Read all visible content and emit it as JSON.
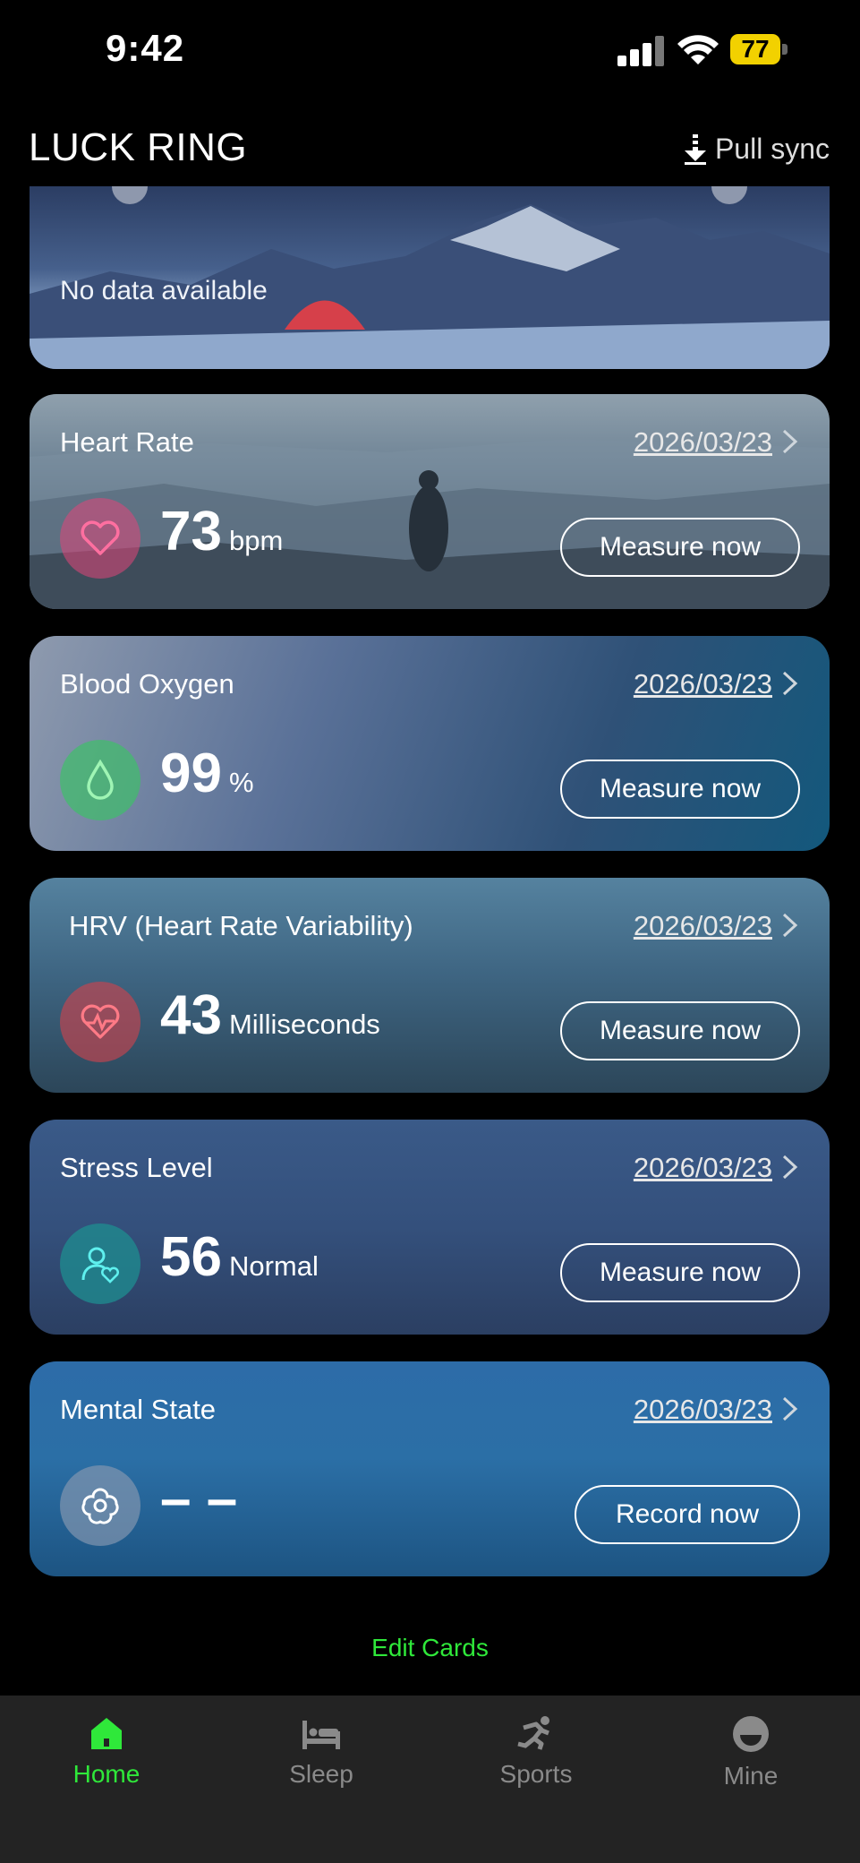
{
  "status_bar": {
    "time": "9:42",
    "battery": "77"
  },
  "header": {
    "title": "LUCK RING",
    "sync_label": "Pull sync",
    "sync_icon": "pull-down-arrow-icon"
  },
  "banner": {
    "text": "No data available"
  },
  "cards": [
    {
      "title": "Heart Rate",
      "date": "2026/03/23",
      "value": "73",
      "unit": "bpm",
      "button": "Measure now",
      "icon": "heart-icon",
      "icon_color": "#e0467a"
    },
    {
      "title": "Blood Oxygen",
      "date": "2026/03/23",
      "value": "99",
      "unit": "%",
      "button": "Measure now",
      "icon": "droplet-icon",
      "icon_color": "#3fbf6a"
    },
    {
      "title": "HRV (Heart Rate Variability)",
      "date": "2026/03/23",
      "value": "43",
      "unit": "Milliseconds",
      "button": "Measure now",
      "icon": "heart-pulse-icon",
      "icon_color": "#c8434f"
    },
    {
      "title": "Stress Level",
      "date": "2026/03/23",
      "value": "56",
      "unit": "Normal",
      "button": "Measure now",
      "icon": "person-heart-icon",
      "icon_color": "#1f8a8f"
    },
    {
      "title": "Mental State",
      "date": "2026/03/23",
      "value": "– –",
      "unit": "",
      "button": "Record now",
      "icon": "flower-icon",
      "icon_color": "#6f8aa5"
    }
  ],
  "edit_cards_label": "Edit Cards",
  "tabs": [
    {
      "label": "Home",
      "icon": "home-icon",
      "active": true
    },
    {
      "label": "Sleep",
      "icon": "bed-icon",
      "active": false
    },
    {
      "label": "Sports",
      "icon": "running-icon",
      "active": false
    },
    {
      "label": "Mine",
      "icon": "profile-icon",
      "active": false
    }
  ],
  "colors": {
    "accent": "#2fe83a",
    "background": "#000000",
    "tabbar": "#232323"
  }
}
